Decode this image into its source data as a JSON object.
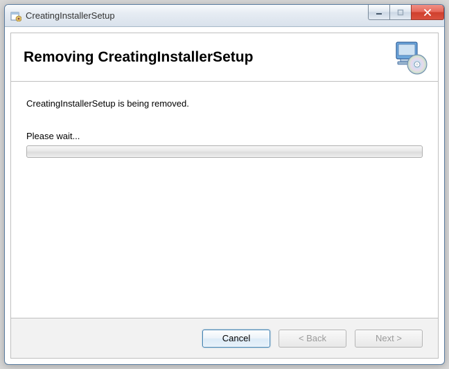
{
  "window": {
    "title": "CreatingInstallerSetup"
  },
  "header": {
    "heading": "Removing CreatingInstallerSetup"
  },
  "body": {
    "status": "CreatingInstallerSetup is being removed.",
    "wait": "Please wait..."
  },
  "footer": {
    "cancel": "Cancel",
    "back": "< Back",
    "next": "Next >"
  }
}
